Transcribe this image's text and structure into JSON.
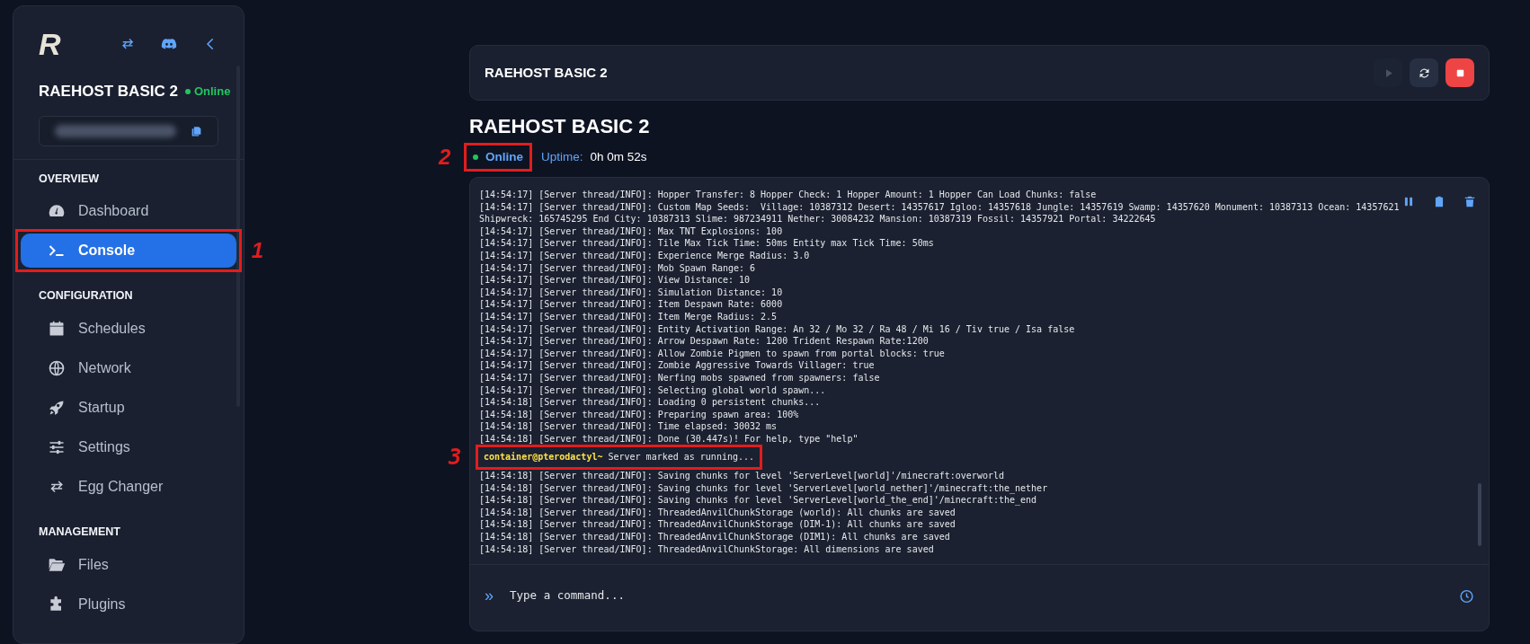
{
  "sidebar": {
    "logo": "R",
    "top_icons": [
      {
        "kind": "swap"
      },
      {
        "kind": "discord"
      },
      {
        "kind": "collapse"
      }
    ],
    "server_name": "RAEHOST BASIC 2",
    "status": "Online",
    "sections": [
      {
        "title": "OVERVIEW",
        "items": [
          {
            "label": "Dashboard",
            "kind": "gauge",
            "selected": false
          },
          {
            "label": "Console",
            "kind": "terminal",
            "selected": true,
            "annotation": "1"
          }
        ]
      },
      {
        "title": "CONFIGURATION",
        "items": [
          {
            "label": "Schedules",
            "kind": "calendar",
            "selected": false
          },
          {
            "label": "Network",
            "kind": "globe",
            "selected": false
          },
          {
            "label": "Startup",
            "kind": "rocket",
            "selected": false
          },
          {
            "label": "Settings",
            "kind": "sliders",
            "selected": false
          },
          {
            "label": "Egg Changer",
            "kind": "swap",
            "selected": false
          }
        ]
      },
      {
        "title": "MANAGEMENT",
        "items": [
          {
            "label": "Files",
            "kind": "folder",
            "selected": false
          },
          {
            "label": "Plugins",
            "kind": "puzzle",
            "selected": false
          }
        ]
      }
    ]
  },
  "header": {
    "title": "RAEHOST BASIC 2",
    "buttons": [
      {
        "kind": "start",
        "disabled": true
      },
      {
        "kind": "restart",
        "disabled": false
      },
      {
        "kind": "stop",
        "disabled": false
      }
    ]
  },
  "server": {
    "title": "RAEHOST BASIC 2",
    "status": "Online",
    "status_annotation": "2",
    "uptime_label": "Uptime:",
    "uptime": "0h 0m 52s"
  },
  "console": {
    "lines": [
      {
        "kind": "log",
        "text": "[14:54:17] [Server thread/INFO]: Hopper Transfer: 8 Hopper Check: 1 Hopper Amount: 1 Hopper Can Load Chunks: false"
      },
      {
        "kind": "log",
        "text": "[14:54:17] [Server thread/INFO]: Custom Map Seeds:  Village: 10387312 Desert: 14357617 Igloo: 14357618 Jungle: 14357619 Swamp: 14357620 Monument: 10387313 Ocean: 14357621 Shipwreck: 165745295 End City: 10387313 Slime: 987234911 Nether: 30084232 Mansion: 10387319 Fossil: 14357921 Portal: 34222645"
      },
      {
        "kind": "log",
        "text": "[14:54:17] [Server thread/INFO]: Max TNT Explosions: 100"
      },
      {
        "kind": "log",
        "text": "[14:54:17] [Server thread/INFO]: Tile Max Tick Time: 50ms Entity max Tick Time: 50ms"
      },
      {
        "kind": "log",
        "text": "[14:54:17] [Server thread/INFO]: Experience Merge Radius: 3.0"
      },
      {
        "kind": "log",
        "text": "[14:54:17] [Server thread/INFO]: Mob Spawn Range: 6"
      },
      {
        "kind": "log",
        "text": "[14:54:17] [Server thread/INFO]: View Distance: 10"
      },
      {
        "kind": "log",
        "text": "[14:54:17] [Server thread/INFO]: Simulation Distance: 10"
      },
      {
        "kind": "log",
        "text": "[14:54:17] [Server thread/INFO]: Item Despawn Rate: 6000"
      },
      {
        "kind": "log",
        "text": "[14:54:17] [Server thread/INFO]: Item Merge Radius: 2.5"
      },
      {
        "kind": "log",
        "text": "[14:54:17] [Server thread/INFO]: Entity Activation Range: An 32 / Mo 32 / Ra 48 / Mi 16 / Tiv true / Isa false"
      },
      {
        "kind": "log",
        "text": "[14:54:17] [Server thread/INFO]: Arrow Despawn Rate: 1200 Trident Respawn Rate:1200"
      },
      {
        "kind": "log",
        "text": "[14:54:17] [Server thread/INFO]: Allow Zombie Pigmen to spawn from portal blocks: true"
      },
      {
        "kind": "log",
        "text": "[14:54:17] [Server thread/INFO]: Zombie Aggressive Towards Villager: true"
      },
      {
        "kind": "log",
        "text": "[14:54:17] [Server thread/INFO]: Nerfing mobs spawned from spawners: false"
      },
      {
        "kind": "log",
        "text": "[14:54:17] [Server thread/INFO]: Selecting global world spawn..."
      },
      {
        "kind": "log",
        "text": "[14:54:18] [Server thread/INFO]: Loading 0 persistent chunks..."
      },
      {
        "kind": "log",
        "text": "[14:54:18] [Server thread/INFO]: Preparing spawn area: 100%"
      },
      {
        "kind": "log",
        "text": "[14:54:18] [Server thread/INFO]: Time elapsed: 30032 ms"
      },
      {
        "kind": "log",
        "text": "[14:54:18] [Server thread/INFO]: Done (30.447s)! For help, type \"help\""
      },
      {
        "kind": "daemon",
        "prompt": "container@pterodactyl~",
        "text": "Server marked as running...",
        "annotation": "3"
      },
      {
        "kind": "log",
        "text": "[14:54:18] [Server thread/INFO]: Saving chunks for level 'ServerLevel[world]'/minecraft:overworld"
      },
      {
        "kind": "log",
        "text": "[14:54:18] [Server thread/INFO]: Saving chunks for level 'ServerLevel[world_nether]'/minecraft:the_nether"
      },
      {
        "kind": "log",
        "text": "[14:54:18] [Server thread/INFO]: Saving chunks for level 'ServerLevel[world_the_end]'/minecraft:the_end"
      },
      {
        "kind": "log",
        "text": "[14:54:18] [Server thread/INFO]: ThreadedAnvilChunkStorage (world): All chunks are saved"
      },
      {
        "kind": "log",
        "text": "[14:54:18] [Server thread/INFO]: ThreadedAnvilChunkStorage (DIM-1): All chunks are saved"
      },
      {
        "kind": "log",
        "text": "[14:54:18] [Server thread/INFO]: ThreadedAnvilChunkStorage (DIM1): All chunks are saved"
      },
      {
        "kind": "log",
        "text": "[14:54:18] [Server thread/INFO]: ThreadedAnvilChunkStorage: All dimensions are saved"
      }
    ],
    "prompt_symbol": "»",
    "placeholder": "Type a command..."
  }
}
